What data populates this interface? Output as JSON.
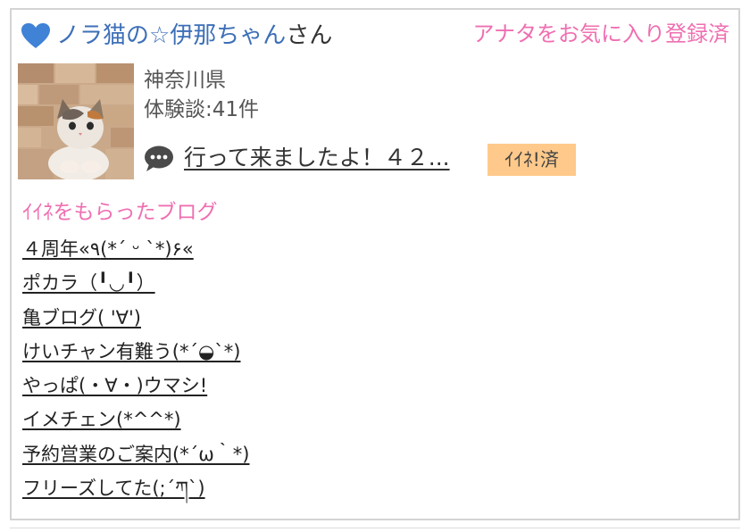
{
  "profile": {
    "nickname": "ノラ猫の☆伊那ちゃん",
    "honorific": "さん",
    "favorite_status": "アナタをお気に入り登録済",
    "prefecture": "神奈川県",
    "review_count": "体験談:41件",
    "latest_review_title": "行って来ましたよ！４２...",
    "iine_status": "ｲｲﾈ!済"
  },
  "liked_blogs": {
    "title": "ｲｲﾈをもらったブログ",
    "items": [
      "４周年«٩(*´ ᵕ `*)۶«",
      "ポカラ（╹◡╹）",
      "亀ブログ( '∀')",
      "けいチャン有難う(*´◒`*)",
      "やっぱ(・∀・)ウマシ!",
      "イメチェン(*^^*)",
      "予約営業のご案内(*´ω｀*)",
      "フリーズしてた(;´ཀ`)"
    ]
  },
  "colors": {
    "name_blue": "#3d6fb8",
    "accent_pink": "#ef6fb1",
    "badge_orange": "#ffc98b"
  },
  "icons": [
    "heart-icon",
    "chat-bubble-icon"
  ]
}
